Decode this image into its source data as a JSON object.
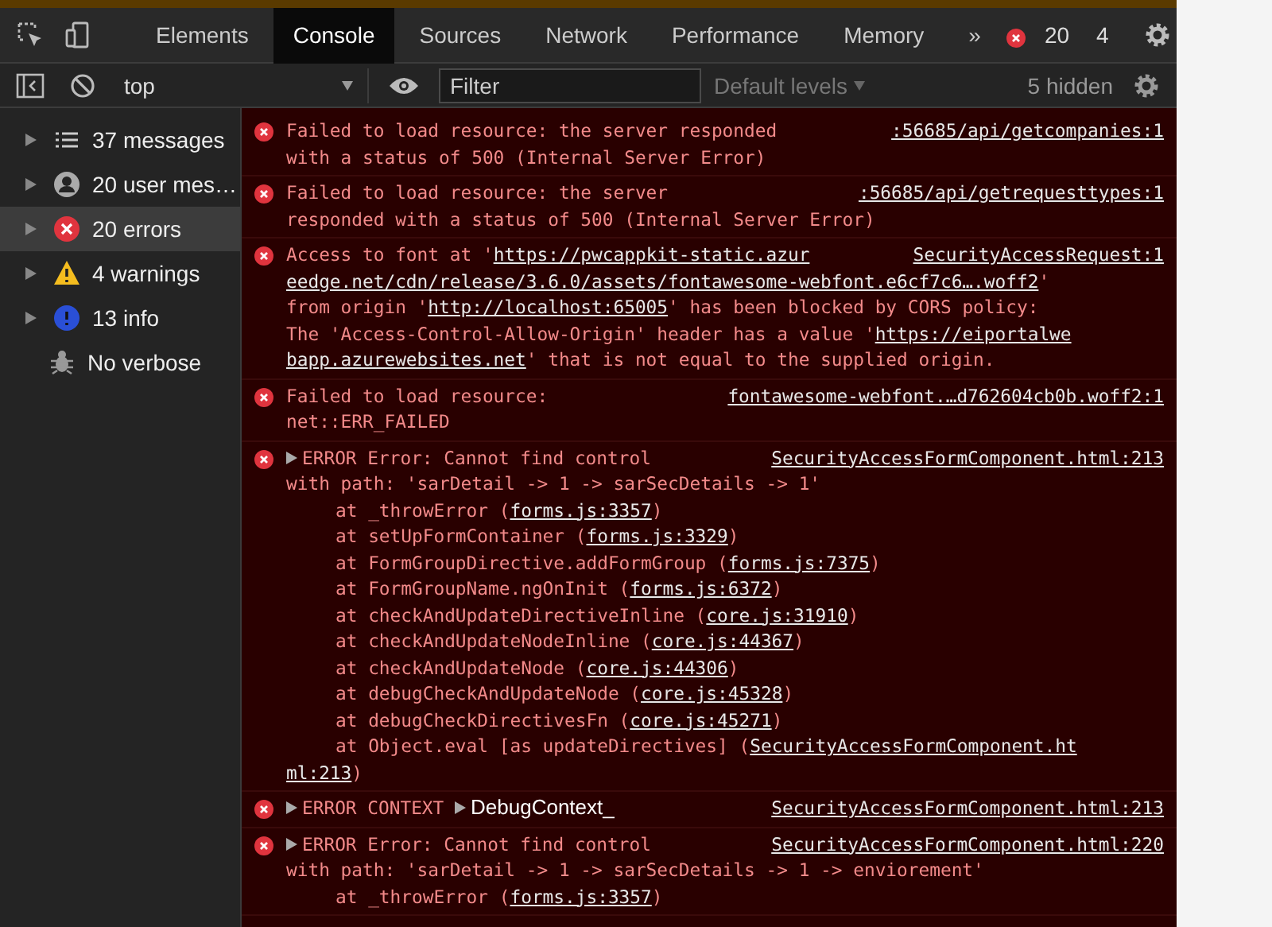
{
  "tabs": [
    {
      "label": "Elements",
      "selected": false
    },
    {
      "label": "Console",
      "selected": true
    },
    {
      "label": "Sources",
      "selected": false
    },
    {
      "label": "Network",
      "selected": false
    },
    {
      "label": "Performance",
      "selected": false
    },
    {
      "label": "Memory",
      "selected": false
    }
  ],
  "more_tabs": "»",
  "error_count": "20",
  "warning_count": "4",
  "console_toolbar": {
    "context": "top",
    "filter": {
      "placeholder": "Filter"
    },
    "levels": "Default levels",
    "hidden": "5 hidden"
  },
  "sidebar": [
    {
      "kind": "list",
      "label": "37 messages",
      "selected": false
    },
    {
      "kind": "user",
      "label": "20 user mes…",
      "selected": false
    },
    {
      "kind": "error",
      "label": "20 errors",
      "selected": true
    },
    {
      "kind": "warning",
      "label": "4 warnings",
      "selected": false
    },
    {
      "kind": "info",
      "label": "13 info",
      "selected": false
    },
    {
      "kind": "verbose",
      "label": "No verbose",
      "selected": false
    }
  ],
  "messages": [
    {
      "source": ":56685/api/getcompanies:1",
      "expandable": false,
      "lines": [
        {
          "kind": "message",
          "parts": [
            {
              "kind": "text",
              "text": "Failed to load resource: the server responded"
            }
          ]
        },
        {
          "kind": "message",
          "parts": [
            {
              "kind": "text",
              "text": "with a status of 500 (Internal Server Error)"
            }
          ]
        }
      ]
    },
    {
      "source": ":56685/api/getrequesttypes:1",
      "expandable": false,
      "lines": [
        {
          "kind": "message",
          "parts": [
            {
              "kind": "text",
              "text": "Failed to load resource: the server"
            }
          ]
        },
        {
          "kind": "message",
          "parts": [
            {
              "kind": "text",
              "text": "responded with a status of 500 (Internal Server Error)"
            }
          ]
        }
      ]
    },
    {
      "source": "SecurityAccessRequest:1",
      "expandable": false,
      "lines": [
        {
          "kind": "message",
          "parts": [
            {
              "kind": "text",
              "text": "Access to font at '"
            },
            {
              "kind": "link",
              "text": "https://pwcappkit-static.azur"
            }
          ]
        },
        {
          "kind": "message",
          "parts": [
            {
              "kind": "link",
              "text": "eedge.net/cdn/release/3.6.0/assets/fontawesome-webfont.e6cf7c6….woff2"
            },
            {
              "kind": "text",
              "text": "'"
            }
          ]
        },
        {
          "kind": "message",
          "parts": [
            {
              "kind": "text",
              "text": "from origin '"
            },
            {
              "kind": "link",
              "text": "http://localhost:65005"
            },
            {
              "kind": "text",
              "text": "' has been blocked by CORS policy:"
            }
          ]
        },
        {
          "kind": "message",
          "parts": [
            {
              "kind": "text",
              "text": "The 'Access-Control-Allow-Origin' header has a value '"
            },
            {
              "kind": "link",
              "text": "https://eiportalwe"
            }
          ]
        },
        {
          "kind": "message",
          "parts": [
            {
              "kind": "link",
              "text": "bapp.azurewebsites.net"
            },
            {
              "kind": "text",
              "text": "' that is not equal to the supplied origin."
            }
          ]
        }
      ]
    },
    {
      "source": "fontawesome-webfont.…d762604cb0b.woff2:1",
      "expandable": false,
      "lines": [
        {
          "kind": "message",
          "parts": [
            {
              "kind": "text",
              "text": "Failed to load resource:"
            }
          ]
        },
        {
          "kind": "message",
          "parts": [
            {
              "kind": "text",
              "text": "net::ERR_FAILED"
            }
          ]
        }
      ]
    },
    {
      "source": "SecurityAccessFormComponent.html:213",
      "expandable": true,
      "lines": [
        {
          "kind": "message",
          "parts": [
            {
              "kind": "text",
              "text": "ERROR Error: Cannot find control"
            }
          ]
        },
        {
          "kind": "message",
          "parts": [
            {
              "kind": "text",
              "text": "with path: 'sarDetail -> 1 -> sarSecDetails -> 1'"
            }
          ]
        },
        {
          "kind": "frame",
          "parts": [
            {
              "kind": "text",
              "text": "at _throwError ("
            },
            {
              "kind": "link",
              "text": "forms.js:3357"
            },
            {
              "kind": "text",
              "text": ")"
            }
          ]
        },
        {
          "kind": "frame",
          "parts": [
            {
              "kind": "text",
              "text": "at setUpFormContainer ("
            },
            {
              "kind": "link",
              "text": "forms.js:3329"
            },
            {
              "kind": "text",
              "text": ")"
            }
          ]
        },
        {
          "kind": "frame",
          "parts": [
            {
              "kind": "text",
              "text": "at FormGroupDirective.addFormGroup ("
            },
            {
              "kind": "link",
              "text": "forms.js:7375"
            },
            {
              "kind": "text",
              "text": ")"
            }
          ]
        },
        {
          "kind": "frame",
          "parts": [
            {
              "kind": "text",
              "text": "at FormGroupName.ngOnInit ("
            },
            {
              "kind": "link",
              "text": "forms.js:6372"
            },
            {
              "kind": "text",
              "text": ")"
            }
          ]
        },
        {
          "kind": "frame",
          "parts": [
            {
              "kind": "text",
              "text": "at checkAndUpdateDirectiveInline ("
            },
            {
              "kind": "link",
              "text": "core.js:31910"
            },
            {
              "kind": "text",
              "text": ")"
            }
          ]
        },
        {
          "kind": "frame",
          "parts": [
            {
              "kind": "text",
              "text": "at checkAndUpdateNodeInline ("
            },
            {
              "kind": "link",
              "text": "core.js:44367"
            },
            {
              "kind": "text",
              "text": ")"
            }
          ]
        },
        {
          "kind": "frame",
          "parts": [
            {
              "kind": "text",
              "text": "at checkAndUpdateNode ("
            },
            {
              "kind": "link",
              "text": "core.js:44306"
            },
            {
              "kind": "text",
              "text": ")"
            }
          ]
        },
        {
          "kind": "frame",
          "parts": [
            {
              "kind": "text",
              "text": "at debugCheckAndUpdateNode ("
            },
            {
              "kind": "link",
              "text": "core.js:45328"
            },
            {
              "kind": "text",
              "text": ")"
            }
          ]
        },
        {
          "kind": "frame",
          "parts": [
            {
              "kind": "text",
              "text": "at debugCheckDirectivesFn ("
            },
            {
              "kind": "link",
              "text": "core.js:45271"
            },
            {
              "kind": "text",
              "text": ")"
            }
          ]
        },
        {
          "kind": "frame",
          "parts": [
            {
              "kind": "text",
              "text": "at Object.eval [as updateDirectives] ("
            },
            {
              "kind": "link",
              "text": "SecurityAccessFormComponent.ht"
            }
          ]
        },
        {
          "kind": "message",
          "parts": [
            {
              "kind": "link",
              "text": "ml:213"
            },
            {
              "kind": "text",
              "text": ")"
            }
          ]
        }
      ]
    },
    {
      "source": "SecurityAccessFormComponent.html:213",
      "expandable": true,
      "lines": [
        {
          "kind": "message",
          "parts": [
            {
              "kind": "text",
              "text": "ERROR CONTEXT "
            },
            {
              "kind": "object",
              "text": "DebugContext_"
            }
          ]
        }
      ]
    },
    {
      "source": "SecurityAccessFormComponent.html:220",
      "expandable": true,
      "lines": [
        {
          "kind": "message",
          "parts": [
            {
              "kind": "text",
              "text": "ERROR Error: Cannot find control"
            }
          ]
        },
        {
          "kind": "message",
          "parts": [
            {
              "kind": "text",
              "text": "with path: 'sarDetail -> 1 -> sarSecDetails -> 1 -> enviorement'"
            }
          ]
        },
        {
          "kind": "frame",
          "parts": [
            {
              "kind": "text",
              "text": "at _throwError ("
            },
            {
              "kind": "link",
              "text": "forms.js:3357"
            },
            {
              "kind": "text",
              "text": ")"
            }
          ]
        }
      ]
    }
  ]
}
